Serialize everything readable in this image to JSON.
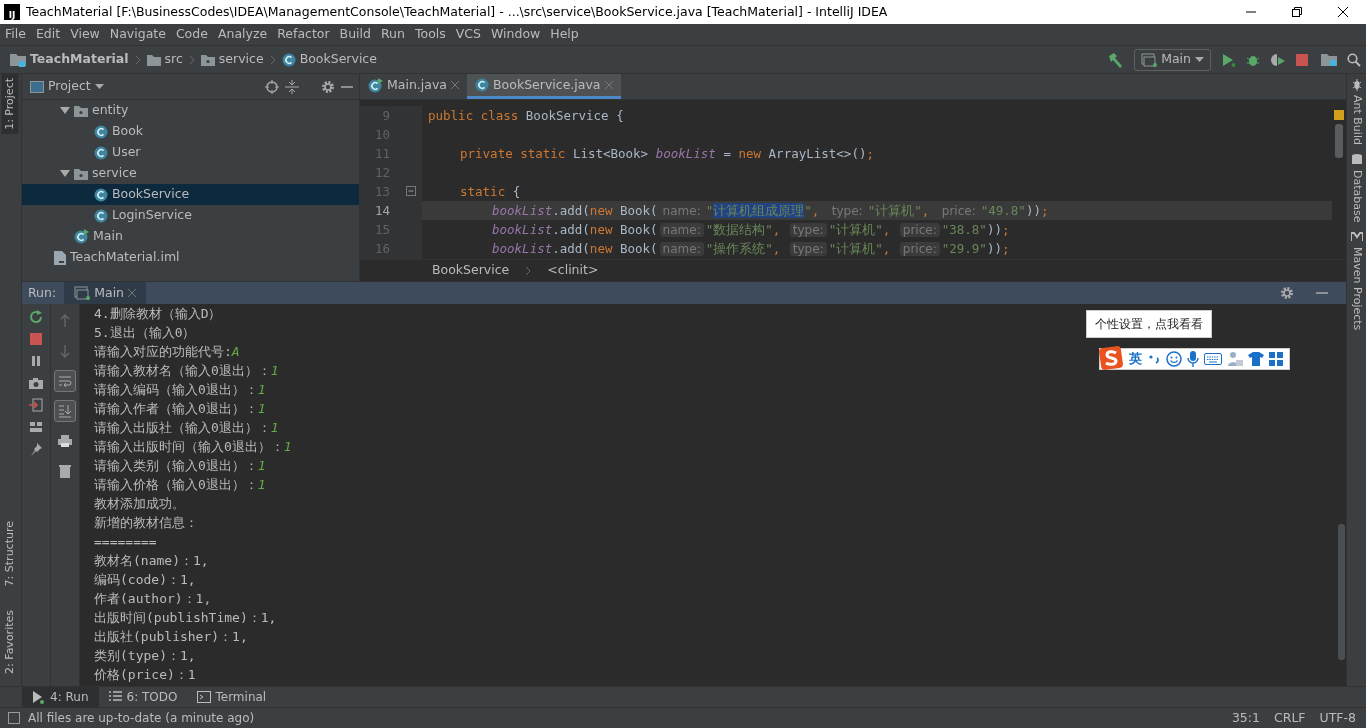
{
  "window": {
    "title": "TeachMaterial [F:\\BusinessCodes\\IDEA\\ManagementConsole\\TeachMaterial] - ...\\src\\service\\BookService.java [TeachMaterial] - IntelliJ IDEA",
    "app_icon": "IJ"
  },
  "menu": [
    "File",
    "Edit",
    "View",
    "Navigate",
    "Code",
    "Analyze",
    "Refactor",
    "Build",
    "Run",
    "Tools",
    "VCS",
    "Window",
    "Help"
  ],
  "breadcrumb": [
    {
      "label": "TeachMaterial",
      "kind": "project"
    },
    {
      "label": "src",
      "kind": "folder"
    },
    {
      "label": "service",
      "kind": "package"
    },
    {
      "label": "BookService",
      "kind": "class"
    }
  ],
  "run_config": "Main",
  "left_stripe": [
    {
      "label": "1: Project",
      "selected": true,
      "kind": "top"
    },
    {
      "label": "7: Structure",
      "selected": false,
      "kind": "bottom"
    },
    {
      "label": "2: Favorites",
      "selected": false,
      "kind": "bottom"
    }
  ],
  "right_stripe": [
    {
      "label": "Ant Build",
      "kind": "ant"
    },
    {
      "label": "Database",
      "kind": "database"
    },
    {
      "label": "Maven Projects",
      "kind": "maven"
    }
  ],
  "project_panel": {
    "title": "Project",
    "tree": [
      {
        "label": "entity",
        "kind": "package",
        "expanded": true,
        "selected": false,
        "children": [
          {
            "label": "Book",
            "kind": "class",
            "selected": false
          },
          {
            "label": "User",
            "kind": "class",
            "selected": false
          }
        ]
      },
      {
        "label": "service",
        "kind": "package",
        "expanded": true,
        "selected": false,
        "children": [
          {
            "label": "BookService",
            "kind": "class",
            "selected": true
          },
          {
            "label": "LoginService",
            "kind": "class",
            "selected": false
          }
        ]
      },
      {
        "label": "Main",
        "kind": "main",
        "selected": false
      },
      {
        "label": "TeachMaterial.iml",
        "kind": "file",
        "selected": false
      }
    ]
  },
  "editor_tabs": [
    {
      "label": "Main.java",
      "kind": "main",
      "selected": false
    },
    {
      "label": "BookService.java",
      "kind": "class",
      "selected": true
    }
  ],
  "code": [
    {
      "line": "9",
      "current": false,
      "kind": "class",
      "tokens": [
        {
          "kind": "keyword",
          "text": "public class "
        },
        {
          "kind": "plain",
          "text": "BookService {"
        }
      ]
    },
    {
      "line": "10",
      "current": false,
      "kind": "blank"
    },
    {
      "line": "11",
      "current": false,
      "kind": "member",
      "tokens": [
        {
          "kind": "keyword",
          "text": "private static "
        },
        {
          "kind": "plain",
          "text": "List<Book> "
        },
        {
          "kind": "field",
          "text": "bookList"
        },
        {
          "kind": "plain",
          "text": " = "
        },
        {
          "kind": "keyword",
          "text": "new "
        },
        {
          "kind": "plain",
          "text": "ArrayList<>()"
        },
        {
          "kind": "keyword",
          "text": ";"
        }
      ]
    },
    {
      "line": "12",
      "current": false,
      "kind": "blank"
    },
    {
      "line": "13",
      "current": false,
      "kind": "member",
      "fold": true,
      "tokens": [
        {
          "kind": "keyword",
          "text": "static "
        },
        {
          "kind": "plain",
          "text": "{"
        }
      ]
    },
    {
      "line": "14",
      "current": true,
      "kind": "statement",
      "tokens": [
        {
          "kind": "field",
          "text": "bookList"
        },
        {
          "kind": "plain",
          "text": ".add("
        },
        {
          "kind": "keyword",
          "text": "new "
        },
        {
          "kind": "plain",
          "text": "Book("
        },
        {
          "kind": "hint",
          "text": "name:"
        },
        {
          "kind": "string",
          "text": "\""
        },
        {
          "kind": "selection",
          "text": "计算机组成原理"
        },
        {
          "kind": "string",
          "text": "\""
        },
        {
          "kind": "keyword",
          "text": ", "
        },
        {
          "kind": "hint",
          "text": "type:"
        },
        {
          "kind": "string",
          "text": "\"计算机\""
        },
        {
          "kind": "keyword",
          "text": ", "
        },
        {
          "kind": "hint",
          "text": "price:"
        },
        {
          "kind": "string",
          "text": "\"49.8\""
        },
        {
          "kind": "plain",
          "text": "))"
        },
        {
          "kind": "keyword",
          "text": ";"
        }
      ]
    },
    {
      "line": "15",
      "current": false,
      "kind": "statement",
      "tokens": [
        {
          "kind": "field",
          "text": "bookList"
        },
        {
          "kind": "plain",
          "text": ".add("
        },
        {
          "kind": "keyword",
          "text": "new "
        },
        {
          "kind": "plain",
          "text": "Book("
        },
        {
          "kind": "hint",
          "text": "name:"
        },
        {
          "kind": "string",
          "text": "\"数据结构\""
        },
        {
          "kind": "keyword",
          "text": ", "
        },
        {
          "kind": "hint",
          "text": "type:"
        },
        {
          "kind": "string",
          "text": "\"计算机\""
        },
        {
          "kind": "keyword",
          "text": ", "
        },
        {
          "kind": "hint",
          "text": "price:"
        },
        {
          "kind": "string",
          "text": "\"38.8\""
        },
        {
          "kind": "plain",
          "text": "))"
        },
        {
          "kind": "keyword",
          "text": ";"
        }
      ]
    },
    {
      "line": "16",
      "current": false,
      "kind": "statement",
      "tokens": [
        {
          "kind": "field",
          "text": "bookList"
        },
        {
          "kind": "plain",
          "text": ".add("
        },
        {
          "kind": "keyword",
          "text": "new "
        },
        {
          "kind": "plain",
          "text": "Book("
        },
        {
          "kind": "hint",
          "text": "name:"
        },
        {
          "kind": "string",
          "text": "\"操作系统\""
        },
        {
          "kind": "keyword",
          "text": ", "
        },
        {
          "kind": "hint",
          "text": "type:"
        },
        {
          "kind": "string",
          "text": "\"计算机\""
        },
        {
          "kind": "keyword",
          "text": ", "
        },
        {
          "kind": "hint",
          "text": "price:"
        },
        {
          "kind": "string",
          "text": "\"29.9\""
        },
        {
          "kind": "plain",
          "text": "))"
        },
        {
          "kind": "keyword",
          "text": ";"
        }
      ]
    }
  ],
  "editor_breadcrumb": [
    "BookService",
    "<clinit>"
  ],
  "run_panel": {
    "label": "Run:",
    "tabs": [
      {
        "label": "Main",
        "selected": true
      }
    ],
    "toggles": [
      {
        "kind": "up",
        "on": false
      },
      {
        "kind": "down",
        "on": false
      },
      {
        "kind": "wrap",
        "on": true
      },
      {
        "kind": "scroll",
        "on": true
      },
      {
        "kind": "print",
        "on": false
      },
      {
        "kind": "trash",
        "on": false
      }
    ],
    "console": [
      {
        "text": "4.删除教材（输入D）"
      },
      {
        "text": "5.退出（输入0）"
      },
      {
        "text": "请输入对应的功能代号:",
        "input": "A"
      },
      {
        "text": "请输入教材名（输入0退出）：",
        "input": "1"
      },
      {
        "text": "请输入编码（输入0退出）：",
        "input": "1"
      },
      {
        "text": "请输入作者（输入0退出）：",
        "input": "1"
      },
      {
        "text": "请输入出版社（输入0退出）：",
        "input": "1"
      },
      {
        "text": "请输入出版时间（输入0退出）：",
        "input": "1"
      },
      {
        "text": "请输入类别（输入0退出）：",
        "input": "1"
      },
      {
        "text": "请输入价格（输入0退出）：",
        "input": "1"
      },
      {
        "text": "教材添加成功。"
      },
      {
        "text": "新增的教材信息："
      },
      {
        "text": "========"
      },
      {
        "text": "教材名(name)：1,"
      },
      {
        "text": "编码(code)：1,"
      },
      {
        "text": "作者(author)：1,"
      },
      {
        "text": "出版时间(publishTime)：1,"
      },
      {
        "text": "出版社(publisher)：1,"
      },
      {
        "text": "类别(type)：1,"
      },
      {
        "text": "价格(price)：1"
      }
    ]
  },
  "ime": {
    "tooltip": "个性设置，点我看看",
    "mode": "英"
  },
  "tool_tabs": [
    {
      "label": "4: Run",
      "kind": "run",
      "selected": true
    },
    {
      "label": "6: TODO",
      "kind": "todo",
      "selected": false
    },
    {
      "label": "Terminal",
      "kind": "terminal",
      "selected": false
    }
  ],
  "status": {
    "message": "All files are up-to-date (a minute ago)",
    "position": "35:1",
    "line_separator": "CRLF",
    "encoding": "UTF-8"
  }
}
